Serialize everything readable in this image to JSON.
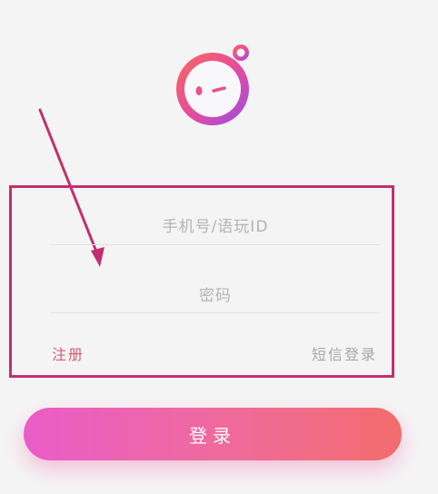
{
  "login_form": {
    "phone_placeholder": "手机号/语玩ID",
    "password_placeholder": "密码",
    "register_label": "注册",
    "sms_login_label": "短信登录"
  },
  "actions": {
    "login_label": "登录"
  },
  "colors": {
    "background": "#f5f4f5",
    "annotation": "#c2306e",
    "register": "#d85a72",
    "button_gradient_start": "#ea5cc8",
    "button_gradient_end": "#f36c6e"
  },
  "icons": {
    "logo": "winking-face-logo-icon",
    "annotation_arrow": "arrow-icon"
  }
}
